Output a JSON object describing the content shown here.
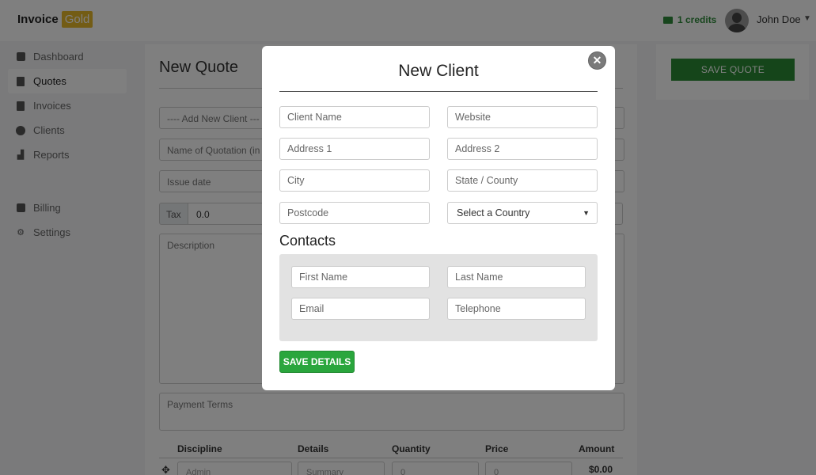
{
  "app": {
    "logo_text": "Invoice",
    "logo_badge": "Gold"
  },
  "header": {
    "credits": "1 credits",
    "user_name": "John Doe"
  },
  "sidebar": {
    "items": [
      {
        "label": "Dashboard",
        "icon": "dashboard-icon"
      },
      {
        "label": "Quotes",
        "icon": "document-icon"
      },
      {
        "label": "Invoices",
        "icon": "invoice-icon"
      },
      {
        "label": "Clients",
        "icon": "user-circle-icon"
      },
      {
        "label": "Reports",
        "icon": "chart-icon"
      },
      {
        "label": "Billing",
        "icon": "wallet-icon"
      },
      {
        "label": "Settings",
        "icon": "user-gear-icon"
      }
    ],
    "active_index": 1
  },
  "quote_form": {
    "title": "New Quote",
    "client_select": "---- Add New Client ---",
    "quotation_name_placeholder": "Name of Quotation (in",
    "issue_date_placeholder": "Issue date",
    "tax_addon": "Tax",
    "tax_value": "0.0",
    "description_placeholder": "Description",
    "payment_terms_placeholder": "Payment Terms",
    "table": {
      "columns": [
        "Discipline",
        "Details",
        "Quantity",
        "Price",
        "Amount"
      ],
      "row": {
        "discipline": "Admin",
        "details": "Summary",
        "quantity": "0",
        "price": "0",
        "amount": "$0.00"
      }
    },
    "save_button": "SAVE QUOTE"
  },
  "modal": {
    "title": "New Client",
    "fields": {
      "client_name": "Client Name",
      "website": "Website",
      "address1": "Address 1",
      "address2": "Address 2",
      "city": "City",
      "state": "State / County",
      "postcode": "Postcode",
      "country": "Select a Country"
    },
    "contacts_heading": "Contacts",
    "contacts": {
      "first_name": "First Name",
      "last_name": "Last Name",
      "email": "Email",
      "telephone": "Telephone"
    },
    "save_button": "SAVE DETAILS",
    "close_icon": "close-icon"
  },
  "colors": {
    "accent_green": "#2aa63d",
    "credits_green": "#2e8b3a",
    "logo_gold": "#e7b92a"
  }
}
